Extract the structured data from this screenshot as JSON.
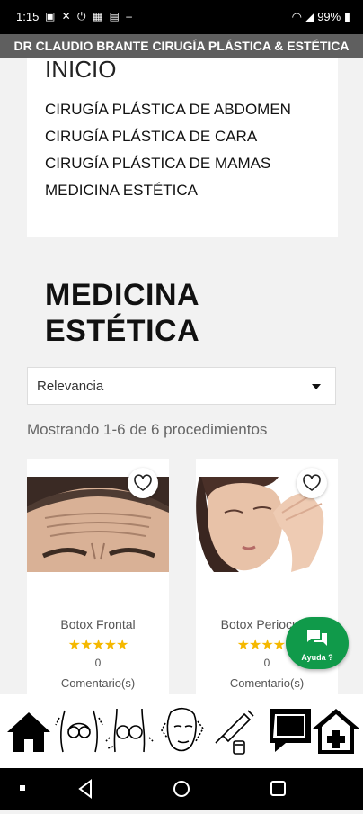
{
  "status_bar": {
    "time": "1:15",
    "battery": "99%"
  },
  "app_title": "DR CLAUDIO BRANTE CIRUGÍA PLÁSTICA & ESTÉTICA",
  "menu": {
    "inicio": "INICIO",
    "items": [
      "CIRUGÍA PLÁSTICA DE ABDOMEN",
      "CIRUGÍA PLÁSTICA DE CARA",
      "CIRUGÍA PLÁSTICA DE MAMAS",
      "MEDICINA ESTÉTICA"
    ]
  },
  "page": {
    "heading_line1": "MEDICINA",
    "heading_line2": "ESTÉTICA",
    "sort_value": "Relevancia",
    "results_text": "Mostrando 1-6 de 6 procedimientos"
  },
  "products": [
    {
      "name": "Botox Frontal",
      "stars": "★★★★★",
      "rating": 5,
      "comments_count": "0",
      "comments_label": "Comentario(s)"
    },
    {
      "name": "Botox Periocular",
      "stars": "★★★★★",
      "rating": 5,
      "comments_count": "0",
      "comments_label": "Comentario(s)"
    }
  ],
  "help_button": {
    "label": "Ayuda ?"
  },
  "bottom_nav": [
    "home-icon",
    "abdomen-icon",
    "breast-icon",
    "face-icon",
    "injection-icon",
    "chat-icon",
    "medical-house-icon"
  ],
  "colors": {
    "title_bar": "#5f5f5f",
    "help_green": "#109a4a",
    "stars": "#f5b800"
  }
}
